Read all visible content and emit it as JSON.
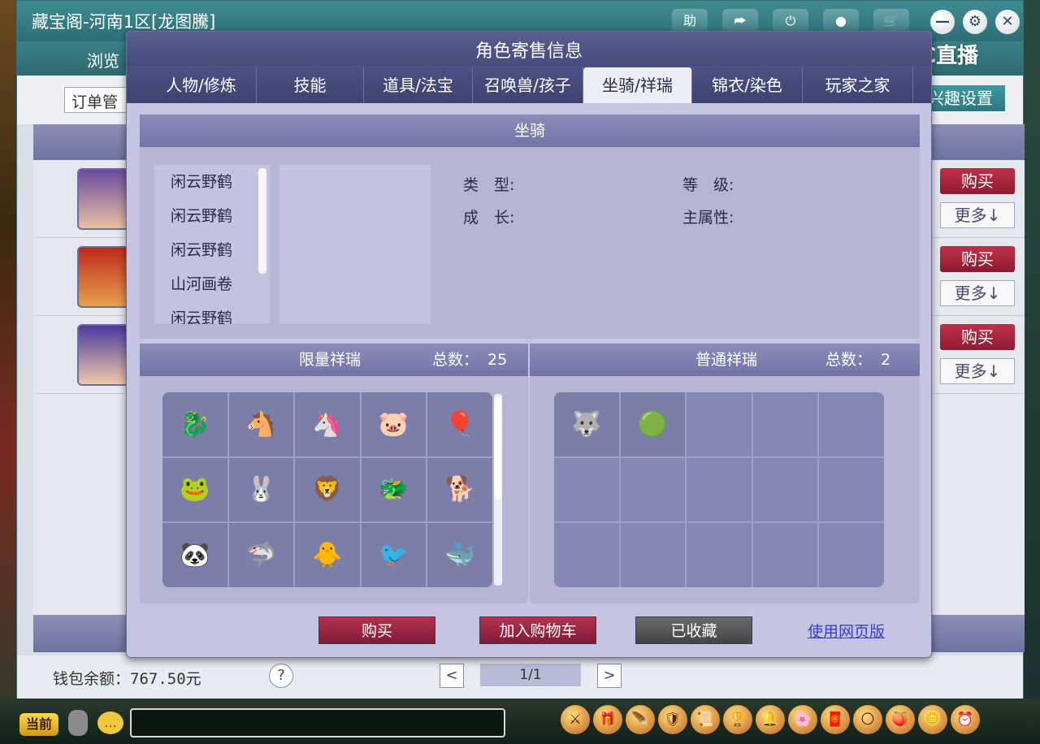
{
  "background_window": {
    "title": "藏宝阁-河南1区[龙图騰]",
    "titlebar_icons": [
      "助",
      "⮫",
      "⏻",
      "●",
      "🛒"
    ],
    "window_buttons": [
      "—",
      "⚙",
      "✕"
    ],
    "nav_visible_label": "浏览",
    "order_dropdown_value": "订单管",
    "interest_settings_label": "兴趣设置",
    "buy_label": "购买",
    "more_label": "更多↓",
    "wallet_text": "钱包余额：767.50元",
    "help_label": "?",
    "page_prev": "<",
    "page_next": ">",
    "page_indicator": "1/1"
  },
  "watermark": {
    "text": "CC直播"
  },
  "modal": {
    "title": "角色寄售信息",
    "tabs": [
      {
        "label": "人物/修炼",
        "active": false
      },
      {
        "label": "技能",
        "active": false
      },
      {
        "label": "道具/法宝",
        "active": false
      },
      {
        "label": "召唤兽/孩子",
        "active": false
      },
      {
        "label": "坐骑/祥瑞",
        "active": true
      },
      {
        "label": "锦衣/染色",
        "active": false
      },
      {
        "label": "玩家之家",
        "active": false
      }
    ],
    "mount_section": {
      "title": "坐骑",
      "items": [
        "闲云野鹤",
        "闲云野鹤",
        "闲云野鹤",
        "山河画卷",
        "闲云野鹤"
      ],
      "attrs": {
        "type_label": "类　型:",
        "growth_label": "成　长:",
        "level_label": "等　级:",
        "main_attr_label": "主属性:"
      }
    },
    "limited_section": {
      "title": "限量祥瑞",
      "total_label": "总数：",
      "total_value": "25",
      "icons": [
        "ice-kirin-icon",
        "black-donkey-icon",
        "armored-donkey-icon",
        "pink-pig-icon",
        "pig-balloon-icon",
        "golden-toad-icon",
        "pink-donkey-icon",
        "white-lion-icon",
        "silver-beast-icon",
        "shiba-dog-icon",
        "panda-icon",
        "blue-shark-icon",
        "golden-chick-icon",
        "blue-dragon-icon",
        "white-dragon-icon"
      ],
      "glyphs": [
        "🐉",
        "🐴",
        "🦄",
        "🐷",
        "🎈",
        "🐸",
        "🐰",
        "🦁",
        "🐲",
        "🐕",
        "🐼",
        "🦈",
        "🐥",
        "🐦",
        "🐳"
      ]
    },
    "normal_section": {
      "title": "普通祥瑞",
      "total_label": "总数：",
      "total_value": "2",
      "icons": [
        "black-white-wolf-icon",
        "green-chick-icon"
      ],
      "glyphs": [
        "🐺",
        "🟢"
      ]
    },
    "buttons": {
      "buy": "购买",
      "add_to_cart": "加入购物车",
      "favorited": "已收藏",
      "web_version": "使用网页版"
    }
  },
  "chatbar": {
    "channel_label": "当前",
    "bubble_label": "…",
    "quick_glyphs": [
      "⚔",
      "🎁",
      "🪶",
      "🛡",
      "📜",
      "🏆",
      "🔔",
      "🌸",
      "🧧",
      "🌕",
      "🍑",
      "🪙",
      "⏰"
    ]
  }
}
